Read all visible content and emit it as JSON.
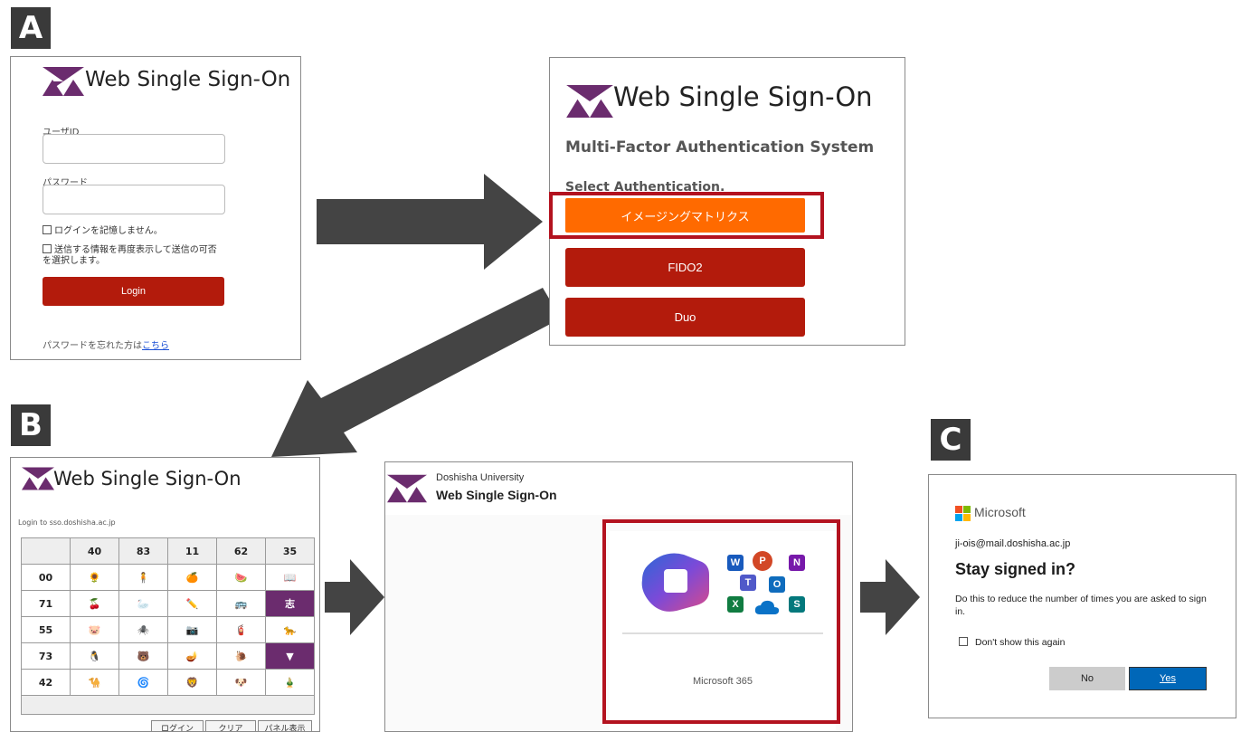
{
  "labels": {
    "a": "A",
    "b": "B",
    "c": "C"
  },
  "panel1": {
    "title": "Web Single Sign-On",
    "user_id_label": "ユーザID",
    "password_label": "パスワード",
    "remember": "ログインを記憶しません。",
    "consent_line1": "送信する情報を再度表示して送信の可否",
    "consent_line2": "を選択します。",
    "login_button": "Login",
    "forgot_text": "パスワードを忘れた方は",
    "forgot_link": "こちら"
  },
  "panel2": {
    "title": "Web Single Sign-On",
    "subtitle": "Multi-Factor Authentication System",
    "select_label": "Select Authentication.",
    "option1": "イメージングマトリクス",
    "option2": "FIDO2",
    "option3": "Duo"
  },
  "panel3": {
    "title": "Web Single Sign-On",
    "login_to": "Login to sso.doshisha.ac.jp",
    "columns": [
      "40",
      "83",
      "11",
      "62",
      "35"
    ],
    "rows": [
      {
        "label": "00",
        "icons": [
          "🌻",
          "🧍",
          "🍊",
          "🍉",
          "📖"
        ]
      },
      {
        "label": "71",
        "icons": [
          "🍒",
          "🦢",
          "✏️",
          "🚌",
          "志"
        ]
      },
      {
        "label": "55",
        "icons": [
          "🐷",
          "🕷️",
          "📷",
          "🧯",
          "🐆"
        ]
      },
      {
        "label": "73",
        "icons": [
          "🐧",
          "🐻",
          "🪔",
          "🐌",
          "▼"
        ]
      },
      {
        "label": "42",
        "icons": [
          "🐪",
          "🌀",
          "🦁",
          "🐶",
          "🎍"
        ]
      }
    ],
    "btn_login": "ログイン",
    "btn_clear": "クリア",
    "btn_panel": "パネル表示"
  },
  "panel4": {
    "university": "Doshisha University",
    "title": "Web Single Sign-On",
    "app_name": "Microsoft 365",
    "app_icons": [
      "W",
      "P",
      "N",
      "T",
      "O",
      "X",
      "S"
    ]
  },
  "panel5": {
    "brand": "Microsoft",
    "email": "ji-ois@mail.doshisha.ac.jp",
    "heading": "Stay signed in?",
    "description": "Do this to reduce the number of times you are asked to sign in.",
    "checkbox": "Don't show this again",
    "no_button": "No",
    "yes_button": "Yes"
  },
  "colors": {
    "logo_purple": "#6b2c6e",
    "button_red": "#b31b0c",
    "button_orange": "#ff6a00",
    "frame_red": "#b3121f",
    "ms_blue": "#0067b8"
  }
}
